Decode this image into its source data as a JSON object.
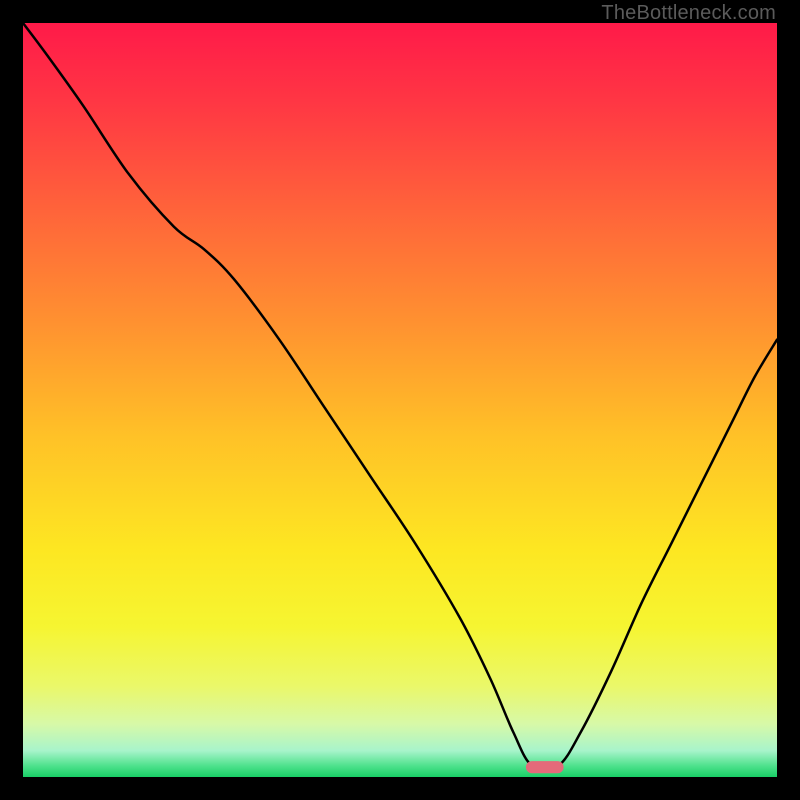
{
  "watermark": "TheBottleneck.com",
  "chart_data": {
    "type": "line",
    "title": "",
    "xlabel": "",
    "ylabel": "",
    "xlim": [
      0,
      100
    ],
    "ylim": [
      0,
      100
    ],
    "grid": false,
    "legend": false,
    "background_gradient": {
      "stops": [
        {
          "offset": 0.0,
          "color": "#ff1a49"
        },
        {
          "offset": 0.1,
          "color": "#ff3544"
        },
        {
          "offset": 0.25,
          "color": "#ff643a"
        },
        {
          "offset": 0.4,
          "color": "#ff9230"
        },
        {
          "offset": 0.55,
          "color": "#ffc227"
        },
        {
          "offset": 0.7,
          "color": "#fde722"
        },
        {
          "offset": 0.8,
          "color": "#f6f531"
        },
        {
          "offset": 0.88,
          "color": "#eaf86a"
        },
        {
          "offset": 0.93,
          "color": "#d7f9a8"
        },
        {
          "offset": 0.965,
          "color": "#a8f4cb"
        },
        {
          "offset": 0.985,
          "color": "#4fe28d"
        },
        {
          "offset": 1.0,
          "color": "#19ce66"
        }
      ]
    },
    "series": [
      {
        "name": "bottleneck-curve",
        "color": "#000000",
        "stroke_width": 2.5,
        "x": [
          0,
          3,
          8,
          14,
          20,
          24,
          28,
          34,
          40,
          46,
          52,
          58,
          62,
          65,
          67.5,
          71,
          74,
          78,
          82,
          86,
          90,
          94,
          97,
          100
        ],
        "values": [
          100,
          96,
          89,
          80,
          73,
          70,
          66,
          58,
          49,
          40,
          31,
          21,
          13,
          6,
          1.5,
          1.5,
          6,
          14,
          23,
          31,
          39,
          47,
          53,
          58
        ]
      }
    ],
    "marker": {
      "name": "optimal-band",
      "shape": "capsule",
      "color": "#e46a7a",
      "x_center": 69.2,
      "y_center": 1.3,
      "width_x_units": 5.0,
      "height_y_units": 1.6
    }
  }
}
